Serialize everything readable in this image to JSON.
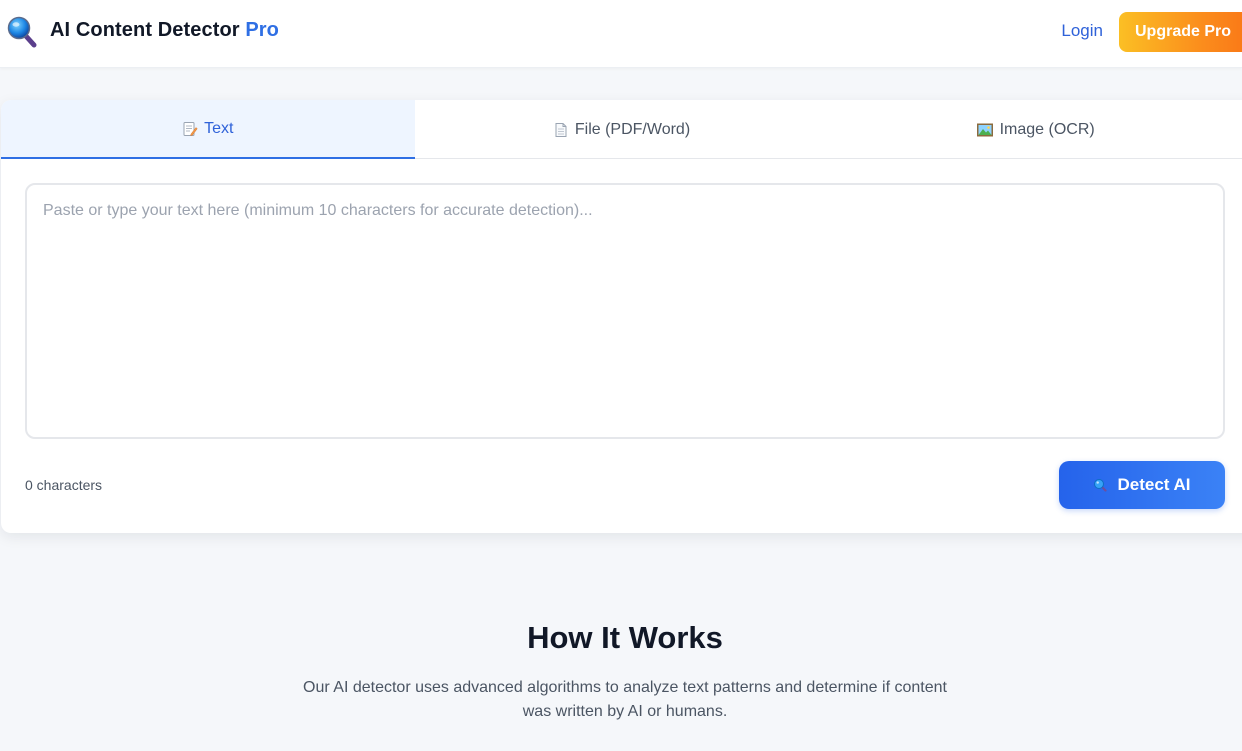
{
  "header": {
    "brand_main": "AI Content Detector",
    "brand_accent": "Pro",
    "login_label": "Login",
    "upgrade_label": "Upgrade Pro",
    "logo_icon": "magnifier-icon"
  },
  "tabs": [
    {
      "label": "Text",
      "icon": "memo-icon",
      "active": true
    },
    {
      "label": "File (PDF/Word)",
      "icon": "document-icon",
      "active": false
    },
    {
      "label": "Image (OCR)",
      "icon": "picture-icon",
      "active": false
    }
  ],
  "editor": {
    "placeholder": "Paste or type your text here (minimum 10 characters for accurate detection)...",
    "value": "",
    "char_count": "0 characters"
  },
  "actions": {
    "detect_label": "Detect AI",
    "detect_icon": "magnifier-icon"
  },
  "how_it_works": {
    "title": "How It Works",
    "description": "Our AI detector uses advanced algorithms to analyze text patterns and determine if content was written by AI or humans."
  },
  "colors": {
    "accent": "#2f6fe4",
    "button_gradient_start": "#2563eb",
    "button_gradient_end": "#3b82f6",
    "upgrade_gradient_start": "#fbbf24",
    "upgrade_gradient_end": "#f97316",
    "page_background": "#f5f7fa"
  }
}
